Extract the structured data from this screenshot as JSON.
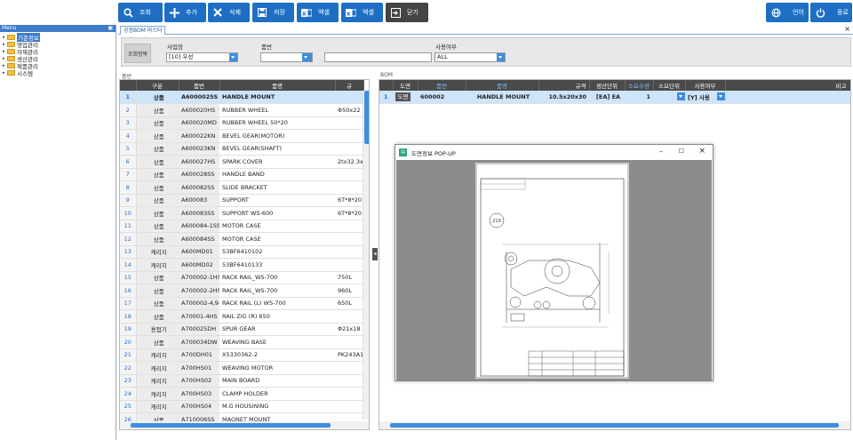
{
  "toolbar": {
    "search": "조회",
    "add": "추가",
    "delete": "삭제",
    "save": "저장",
    "excel1": "엑셀",
    "excel2": "엑셀",
    "close": "닫기",
    "lang": "언어",
    "exit": "종료"
  },
  "menu": {
    "title": "Menu",
    "items": [
      "기준정보",
      "영업관리",
      "자재관리",
      "생산관리",
      "제품관리",
      "시스템"
    ]
  },
  "tab": {
    "label": "공정BOM 마스터"
  },
  "search": {
    "section_label": "조회항목",
    "site_label": "사업장",
    "site_value": "[10] 우성",
    "item_label": "품번",
    "item_value": "",
    "use_label": "사용여부",
    "use_value": "ALL"
  },
  "left_grid": {
    "title": "품번",
    "headers": [
      "",
      "구분",
      "품번",
      "품명",
      "규"
    ],
    "rows": [
      [
        "1",
        "상품",
        "A600002SS",
        "HANDLE MOUNT",
        ""
      ],
      [
        "2",
        "상품",
        "A600020HS",
        "RUBBER WHEEL",
        "Φ50x22"
      ],
      [
        "3",
        "상품",
        "A600020MD",
        "RUBBER WHEEL 50*20",
        ""
      ],
      [
        "4",
        "상품",
        "A600022KN",
        "BEVEL GEAR(MOTOR)",
        ""
      ],
      [
        "5",
        "상품",
        "A600023KN",
        "BEVEL GEAR(SHAFT)",
        ""
      ],
      [
        "6",
        "상품",
        "A600027HS",
        "SPARK COVER",
        "2tx32.3x65"
      ],
      [
        "7",
        "상품",
        "A600028SS",
        "HANDLE BAND",
        ""
      ],
      [
        "8",
        "상품",
        "A600082SS",
        "SLIDE BRACKET",
        ""
      ],
      [
        "9",
        "상품",
        "A600083",
        "SUPPORT",
        "6T*8*20 2"
      ],
      [
        "10",
        "상품",
        "A600083SS",
        "SUPPORT WS-600",
        "6T*8*20 2"
      ],
      [
        "11",
        "상품",
        "A600084-1SS",
        "MOTOR CASE",
        ""
      ],
      [
        "12",
        "상품",
        "A600084SS",
        "MOTOR CASE",
        ""
      ],
      [
        "13",
        "캐리지",
        "A600MD01",
        "53BF6410102",
        ""
      ],
      [
        "14",
        "캐리지",
        "A600MD02",
        "53BF6410133",
        ""
      ],
      [
        "15",
        "상품",
        "A700002-1HS",
        "RACK RAIL_WS-700",
        "750L"
      ],
      [
        "16",
        "상품",
        "A700002-2HS",
        "RACK RAIL_WS-700",
        "960L"
      ],
      [
        "17",
        "상품",
        "A700002-4,9-...",
        "RACK RAIL (L) WS-700",
        "650L"
      ],
      [
        "18",
        "상품",
        "A70001-4HS",
        "RAIL ZIG (R) 650",
        ""
      ],
      [
        "19",
        "용접기",
        "A700025DH",
        "SPUR GEAR",
        "Φ21x18"
      ],
      [
        "20",
        "상품",
        "A700034DW",
        "WEAVING BASE",
        ""
      ],
      [
        "21",
        "캐리지",
        "A700DH01",
        "X5330362-2",
        "PK243A1-S"
      ],
      [
        "22",
        "캐리지",
        "A700HS01",
        "WEAVING MOTOR",
        ""
      ],
      [
        "23",
        "캐리지",
        "A700HS02",
        "MAIN BOARD",
        ""
      ],
      [
        "24",
        "캐리지",
        "A700HS03",
        "CLAMP HOLDER",
        ""
      ],
      [
        "25",
        "캐리지",
        "A700HS04",
        "M.G HOUSINING",
        ""
      ],
      [
        "26",
        "상품",
        "A710006SS",
        "MAGNET MOUNT",
        ""
      ]
    ]
  },
  "right_grid": {
    "title": "BOM",
    "headers": [
      "",
      "도면",
      "품번",
      "품명",
      "규격",
      "생산단위",
      "소요수량",
      "소요단위",
      "사용여부",
      "비고"
    ],
    "row": [
      "1",
      "도면",
      "600002",
      "HANDLE MOUNT",
      "10.5x20x30",
      "[EA] EA",
      "1",
      "",
      "[Y] 사용",
      ""
    ]
  },
  "popup": {
    "title": "도면정보 POP-UP",
    "part_no": "210"
  },
  "colors": {
    "accent": "#1e6fc4",
    "header": "#4a4a4a",
    "selected_row": "#cde4fa"
  }
}
